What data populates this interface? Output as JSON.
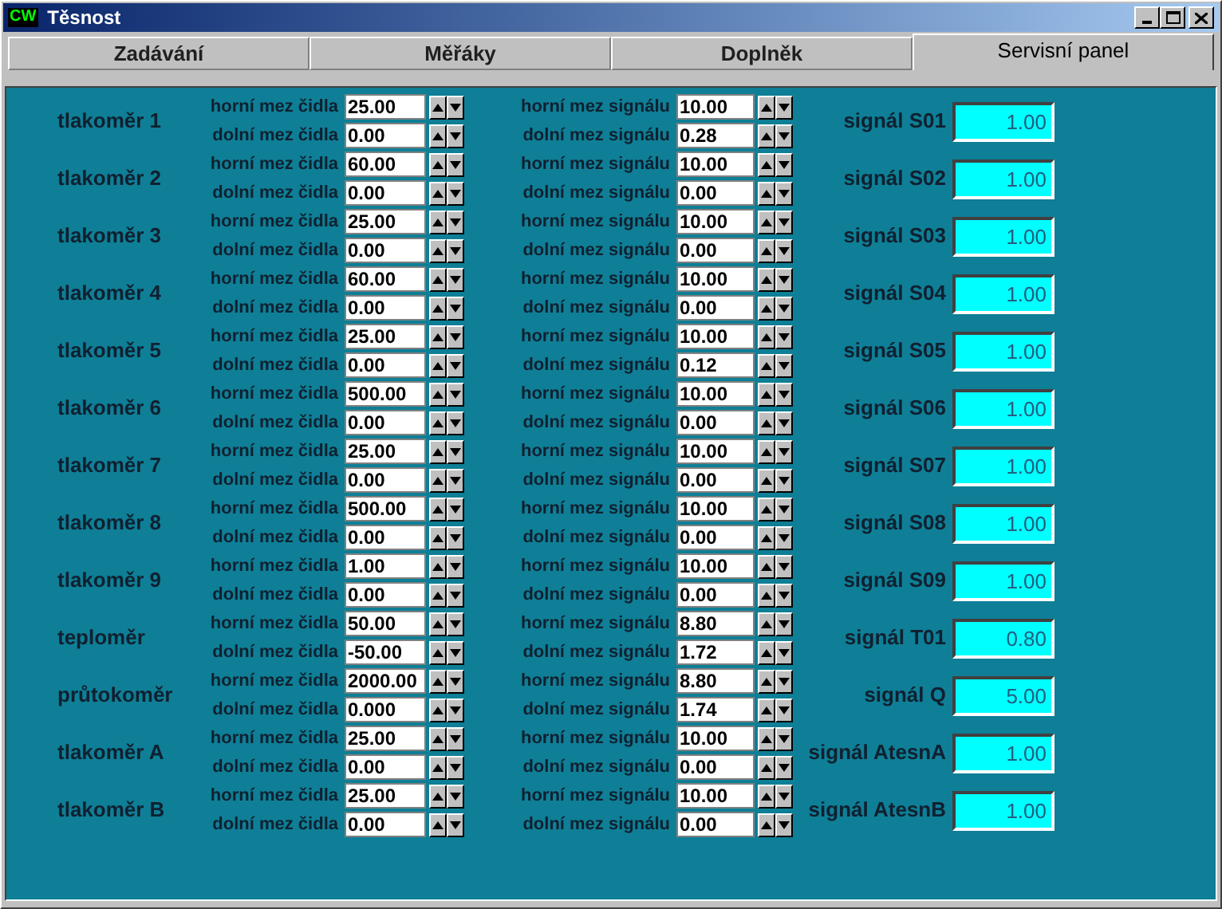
{
  "window": {
    "title": "Těsnost",
    "logo": "CW"
  },
  "tabs": [
    {
      "label": "Zadávání",
      "selected": false
    },
    {
      "label": "Měřáky",
      "selected": false
    },
    {
      "label": "Doplněk",
      "selected": false
    },
    {
      "label": "Servisní panel",
      "selected": true
    }
  ],
  "sensors": [
    {
      "name": "tlakoměr 1",
      "sensor_high_label": "horní mez čidla",
      "sensor_high": "25.00",
      "sensor_low_label": "dolní mez čidla",
      "sensor_low": "0.00",
      "signal_high_label": "horní mez signálu",
      "signal_high": "10.00",
      "signal_low_label": "dolní mez signálu",
      "signal_low": "0.28",
      "signal_label": "signál S01",
      "signal_value": "1.00"
    },
    {
      "name": "tlakoměr 2",
      "sensor_high_label": "horní mez čidla",
      "sensor_high": "60.00",
      "sensor_low_label": "dolní mez čidla",
      "sensor_low": "0.00",
      "signal_high_label": "horní mez signálu",
      "signal_high": "10.00",
      "signal_low_label": "dolní mez signálu",
      "signal_low": "0.00",
      "signal_label": "signál S02",
      "signal_value": "1.00"
    },
    {
      "name": "tlakoměr 3",
      "sensor_high_label": "horní mez čidla",
      "sensor_high": "25.00",
      "sensor_low_label": "dolní mez čidla",
      "sensor_low": "0.00",
      "signal_high_label": "horní mez signálu",
      "signal_high": "10.00",
      "signal_low_label": "dolní mez signálu",
      "signal_low": "0.00",
      "signal_label": "signál S03",
      "signal_value": "1.00"
    },
    {
      "name": "tlakoměr 4",
      "sensor_high_label": "horní mez čidla",
      "sensor_high": "60.00",
      "sensor_low_label": "dolní mez čidla",
      "sensor_low": "0.00",
      "signal_high_label": "horní mez signálu",
      "signal_high": "10.00",
      "signal_low_label": "dolní mez signálu",
      "signal_low": "0.00",
      "signal_label": "signál S04",
      "signal_value": "1.00"
    },
    {
      "name": "tlakoměr 5",
      "sensor_high_label": "horní mez čidla",
      "sensor_high": "25.00",
      "sensor_low_label": "dolní mez čidla",
      "sensor_low": "0.00",
      "signal_high_label": "horní mez signálu",
      "signal_high": "10.00",
      "signal_low_label": "dolní mez signálu",
      "signal_low": "0.12",
      "signal_label": "signál S05",
      "signal_value": "1.00"
    },
    {
      "name": "tlakoměr 6",
      "sensor_high_label": "horní mez čidla",
      "sensor_high": "500.00",
      "sensor_low_label": "dolní mez čidla",
      "sensor_low": "0.00",
      "signal_high_label": "horní mez signálu",
      "signal_high": "10.00",
      "signal_low_label": "dolní mez signálu",
      "signal_low": "0.00",
      "signal_label": "signál S06",
      "signal_value": "1.00"
    },
    {
      "name": "tlakoměr 7",
      "sensor_high_label": "horní mez čidla",
      "sensor_high": "25.00",
      "sensor_low_label": "dolní mez čidla",
      "sensor_low": "0.00",
      "signal_high_label": "horní mez signálu",
      "signal_high": "10.00",
      "signal_low_label": "dolní mez signálu",
      "signal_low": "0.00",
      "signal_label": "signál S07",
      "signal_value": "1.00"
    },
    {
      "name": "tlakoměr 8",
      "sensor_high_label": "horní mez čidla",
      "sensor_high": "500.00",
      "sensor_low_label": "dolní mez čidla",
      "sensor_low": "0.00",
      "signal_high_label": "horní mez signálu",
      "signal_high": "10.00",
      "signal_low_label": "dolní mez signálu",
      "signal_low": "0.00",
      "signal_label": "signál S08",
      "signal_value": "1.00"
    },
    {
      "name": "tlakoměr 9",
      "sensor_high_label": "horní mez čidla",
      "sensor_high": "1.00",
      "sensor_low_label": "dolní mez čidla",
      "sensor_low": "0.00",
      "signal_high_label": "horní mez signálu",
      "signal_high": "10.00",
      "signal_low_label": "dolní mez signálu",
      "signal_low": "0.00",
      "signal_label": "signál S09",
      "signal_value": "1.00"
    },
    {
      "name": "teploměr",
      "sensor_high_label": "horní mez čidla",
      "sensor_high": "50.00",
      "sensor_low_label": "dolní mez čidla",
      "sensor_low": "-50.00",
      "signal_high_label": "horní mez signálu",
      "signal_high": "8.80",
      "signal_low_label": "dolní mez signálu",
      "signal_low": "1.72",
      "signal_label": "signál  T01",
      "signal_value": "0.80"
    },
    {
      "name": "průtokoměr",
      "sensor_high_label": "horní mez čidla",
      "sensor_high": "2000.00",
      "sensor_low_label": "dolní mez čidla",
      "sensor_low": "0.000",
      "signal_high_label": "horní mez signálu",
      "signal_high": "8.80",
      "signal_low_label": "dolní mez signálu",
      "signal_low": "1.74",
      "signal_label": "signál Q",
      "signal_value": "5.00"
    },
    {
      "name": "tlakoměr A",
      "sensor_high_label": "horní mez čidla",
      "sensor_high": "25.00",
      "sensor_low_label": "dolní mez čidla",
      "sensor_low": "0.00",
      "signal_high_label": "horní mez signálu",
      "signal_high": "10.00",
      "signal_low_label": "dolní mez signálu",
      "signal_low": "0.00",
      "signal_label": "signál AtesnA",
      "signal_value": "1.00"
    },
    {
      "name": "tlakoměr B",
      "sensor_high_label": "horní mez čidla",
      "sensor_high": "25.00",
      "sensor_low_label": "dolní mez čidla",
      "sensor_low": "0.00",
      "signal_high_label": "horní mez signálu",
      "signal_high": "10.00",
      "signal_low_label": "dolní mez signálu",
      "signal_low": "0.00",
      "signal_label": "signál AtesnB",
      "signal_value": "1.00"
    }
  ]
}
